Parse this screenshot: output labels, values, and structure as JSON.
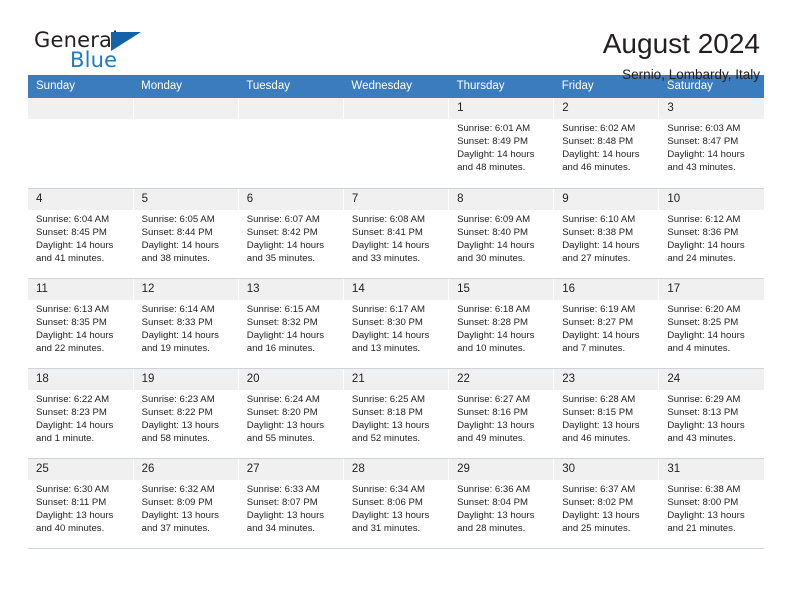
{
  "brand": {
    "name_part1": "General",
    "name_part2": "Blue",
    "logo_icon": "triangle-logo"
  },
  "header": {
    "title": "August 2024",
    "subtitle": "Sernio, Lombardy, Italy"
  },
  "colors": {
    "header_blue": "#3a7cbe",
    "brand_blue": "#1f7bc1",
    "logo_blue": "#1263a8",
    "daynum_bg": "#f0f0f0",
    "text": "#231f20",
    "row_border": "#cfd4d8"
  },
  "calendar": {
    "weekday_headers": [
      "Sunday",
      "Monday",
      "Tuesday",
      "Wednesday",
      "Thursday",
      "Friday",
      "Saturday"
    ],
    "weeks": [
      [
        {
          "blank": true
        },
        {
          "blank": true
        },
        {
          "blank": true
        },
        {
          "blank": true
        },
        {
          "day": "1",
          "sunrise": "Sunrise: 6:01 AM",
          "sunset": "Sunset: 8:49 PM",
          "daylight": "Daylight: 14 hours and 48 minutes."
        },
        {
          "day": "2",
          "sunrise": "Sunrise: 6:02 AM",
          "sunset": "Sunset: 8:48 PM",
          "daylight": "Daylight: 14 hours and 46 minutes."
        },
        {
          "day": "3",
          "sunrise": "Sunrise: 6:03 AM",
          "sunset": "Sunset: 8:47 PM",
          "daylight": "Daylight: 14 hours and 43 minutes."
        }
      ],
      [
        {
          "day": "4",
          "sunrise": "Sunrise: 6:04 AM",
          "sunset": "Sunset: 8:45 PM",
          "daylight": "Daylight: 14 hours and 41 minutes."
        },
        {
          "day": "5",
          "sunrise": "Sunrise: 6:05 AM",
          "sunset": "Sunset: 8:44 PM",
          "daylight": "Daylight: 14 hours and 38 minutes."
        },
        {
          "day": "6",
          "sunrise": "Sunrise: 6:07 AM",
          "sunset": "Sunset: 8:42 PM",
          "daylight": "Daylight: 14 hours and 35 minutes."
        },
        {
          "day": "7",
          "sunrise": "Sunrise: 6:08 AM",
          "sunset": "Sunset: 8:41 PM",
          "daylight": "Daylight: 14 hours and 33 minutes."
        },
        {
          "day": "8",
          "sunrise": "Sunrise: 6:09 AM",
          "sunset": "Sunset: 8:40 PM",
          "daylight": "Daylight: 14 hours and 30 minutes."
        },
        {
          "day": "9",
          "sunrise": "Sunrise: 6:10 AM",
          "sunset": "Sunset: 8:38 PM",
          "daylight": "Daylight: 14 hours and 27 minutes."
        },
        {
          "day": "10",
          "sunrise": "Sunrise: 6:12 AM",
          "sunset": "Sunset: 8:36 PM",
          "daylight": "Daylight: 14 hours and 24 minutes."
        }
      ],
      [
        {
          "day": "11",
          "sunrise": "Sunrise: 6:13 AM",
          "sunset": "Sunset: 8:35 PM",
          "daylight": "Daylight: 14 hours and 22 minutes."
        },
        {
          "day": "12",
          "sunrise": "Sunrise: 6:14 AM",
          "sunset": "Sunset: 8:33 PM",
          "daylight": "Daylight: 14 hours and 19 minutes."
        },
        {
          "day": "13",
          "sunrise": "Sunrise: 6:15 AM",
          "sunset": "Sunset: 8:32 PM",
          "daylight": "Daylight: 14 hours and 16 minutes."
        },
        {
          "day": "14",
          "sunrise": "Sunrise: 6:17 AM",
          "sunset": "Sunset: 8:30 PM",
          "daylight": "Daylight: 14 hours and 13 minutes."
        },
        {
          "day": "15",
          "sunrise": "Sunrise: 6:18 AM",
          "sunset": "Sunset: 8:28 PM",
          "daylight": "Daylight: 14 hours and 10 minutes."
        },
        {
          "day": "16",
          "sunrise": "Sunrise: 6:19 AM",
          "sunset": "Sunset: 8:27 PM",
          "daylight": "Daylight: 14 hours and 7 minutes."
        },
        {
          "day": "17",
          "sunrise": "Sunrise: 6:20 AM",
          "sunset": "Sunset: 8:25 PM",
          "daylight": "Daylight: 14 hours and 4 minutes."
        }
      ],
      [
        {
          "day": "18",
          "sunrise": "Sunrise: 6:22 AM",
          "sunset": "Sunset: 8:23 PM",
          "daylight": "Daylight: 14 hours and 1 minute."
        },
        {
          "day": "19",
          "sunrise": "Sunrise: 6:23 AM",
          "sunset": "Sunset: 8:22 PM",
          "daylight": "Daylight: 13 hours and 58 minutes."
        },
        {
          "day": "20",
          "sunrise": "Sunrise: 6:24 AM",
          "sunset": "Sunset: 8:20 PM",
          "daylight": "Daylight: 13 hours and 55 minutes."
        },
        {
          "day": "21",
          "sunrise": "Sunrise: 6:25 AM",
          "sunset": "Sunset: 8:18 PM",
          "daylight": "Daylight: 13 hours and 52 minutes."
        },
        {
          "day": "22",
          "sunrise": "Sunrise: 6:27 AM",
          "sunset": "Sunset: 8:16 PM",
          "daylight": "Daylight: 13 hours and 49 minutes."
        },
        {
          "day": "23",
          "sunrise": "Sunrise: 6:28 AM",
          "sunset": "Sunset: 8:15 PM",
          "daylight": "Daylight: 13 hours and 46 minutes."
        },
        {
          "day": "24",
          "sunrise": "Sunrise: 6:29 AM",
          "sunset": "Sunset: 8:13 PM",
          "daylight": "Daylight: 13 hours and 43 minutes."
        }
      ],
      [
        {
          "day": "25",
          "sunrise": "Sunrise: 6:30 AM",
          "sunset": "Sunset: 8:11 PM",
          "daylight": "Daylight: 13 hours and 40 minutes."
        },
        {
          "day": "26",
          "sunrise": "Sunrise: 6:32 AM",
          "sunset": "Sunset: 8:09 PM",
          "daylight": "Daylight: 13 hours and 37 minutes."
        },
        {
          "day": "27",
          "sunrise": "Sunrise: 6:33 AM",
          "sunset": "Sunset: 8:07 PM",
          "daylight": "Daylight: 13 hours and 34 minutes."
        },
        {
          "day": "28",
          "sunrise": "Sunrise: 6:34 AM",
          "sunset": "Sunset: 8:06 PM",
          "daylight": "Daylight: 13 hours and 31 minutes."
        },
        {
          "day": "29",
          "sunrise": "Sunrise: 6:36 AM",
          "sunset": "Sunset: 8:04 PM",
          "daylight": "Daylight: 13 hours and 28 minutes."
        },
        {
          "day": "30",
          "sunrise": "Sunrise: 6:37 AM",
          "sunset": "Sunset: 8:02 PM",
          "daylight": "Daylight: 13 hours and 25 minutes."
        },
        {
          "day": "31",
          "sunrise": "Sunrise: 6:38 AM",
          "sunset": "Sunset: 8:00 PM",
          "daylight": "Daylight: 13 hours and 21 minutes."
        }
      ]
    ]
  }
}
